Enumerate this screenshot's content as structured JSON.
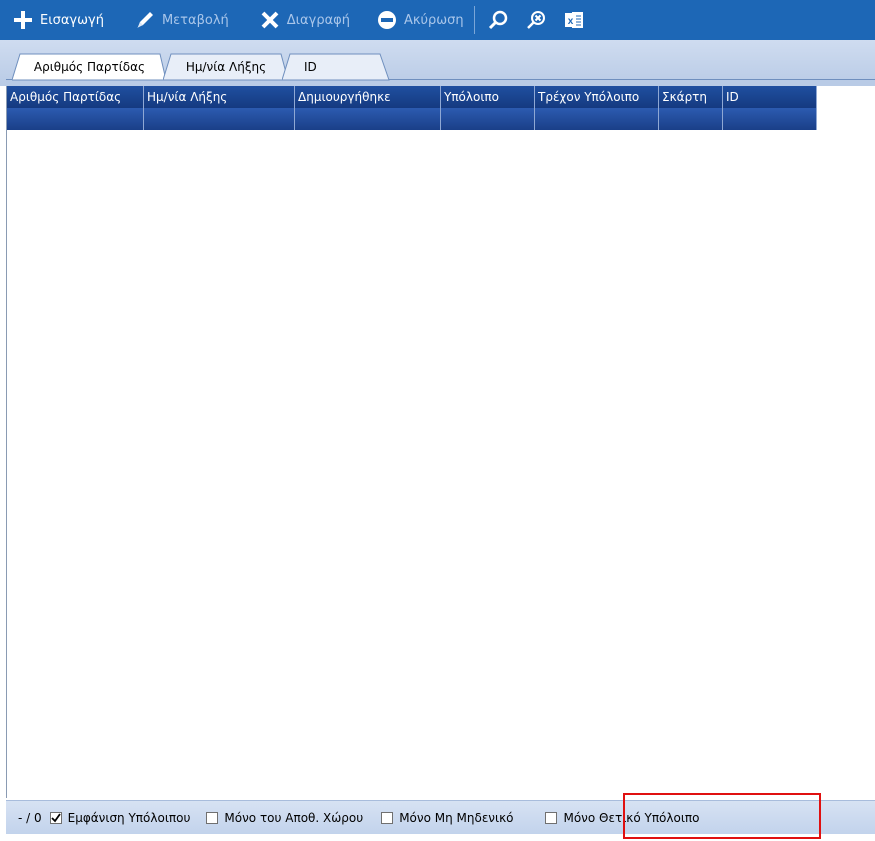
{
  "toolbar": {
    "insert_label": "Εισαγωγή",
    "edit_label": "Μεταβολή",
    "delete_label": "Διαγραφή",
    "cancel_label": "Ακύρωση",
    "icons": [
      "plus-icon",
      "pencil-icon",
      "x-icon",
      "minus-circle-icon",
      "search-icon",
      "clear-search-icon",
      "excel-icon"
    ]
  },
  "tabs": [
    {
      "label": "Αριθμός Παρτίδας",
      "active": true
    },
    {
      "label": "Ημ/νία Λήξης",
      "active": false
    },
    {
      "label": "ID",
      "active": false
    }
  ],
  "grid": {
    "columns": [
      "Αριθμός Παρτίδας",
      "Ημ/νία Λήξης",
      "Δημιουργήθηκε",
      "Υπόλοιπο",
      "Τρέχον Υπόλοιπο",
      "Σκάρτη",
      "ID"
    ]
  },
  "status": {
    "count": "- / 0",
    "options": [
      {
        "label": "Εμφάνιση Υπόλοιπου",
        "checked": true
      },
      {
        "label": "Μόνο του Αποθ. Χώρου",
        "checked": false
      },
      {
        "label": "Μόνο Μη Μηδενικό",
        "checked": false
      },
      {
        "label": "Μόνο Θετικό Υπόλοιπο",
        "checked": false
      }
    ]
  },
  "colors": {
    "toolbar_bg": "#1d67b6",
    "grid_header_bg": "#1f4fa0",
    "highlight": "#e01010"
  }
}
